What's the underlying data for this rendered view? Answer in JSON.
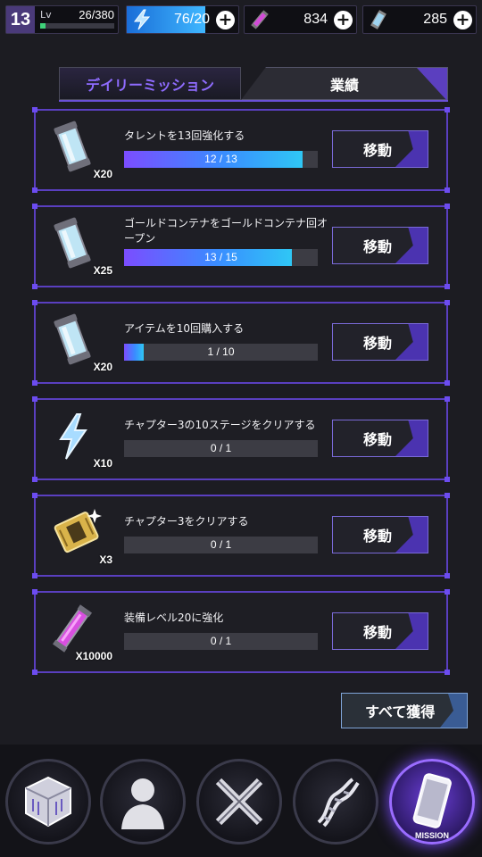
{
  "top_bar": {
    "level": "13",
    "level_label": "Lv",
    "xp_text": "26/380",
    "xp_fraction": 0.07,
    "energy": "76/20",
    "energy_fill_fraction": 0.7,
    "pink_currency": "834",
    "blue_currency": "285",
    "plus_symbol": "+"
  },
  "tabs": [
    {
      "label": "デイリーミッション"
    },
    {
      "label": "業績"
    }
  ],
  "move_label": "移動",
  "missions": [
    {
      "title": "タレントを13回強化する",
      "reward_icon": "blue-canister-icon",
      "reward_count": "X20",
      "progress_text": "12 / 13",
      "fraction": 0.923
    },
    {
      "title": "ゴールドコンテナをゴールドコンテナ回オープン",
      "reward_icon": "blue-canister-icon",
      "reward_count": "X25",
      "progress_text": "13 / 15",
      "fraction": 0.867
    },
    {
      "title": "アイテムを10回購入する",
      "reward_icon": "blue-canister-icon",
      "reward_count": "X20",
      "progress_text": "1 / 10",
      "fraction": 0.1
    },
    {
      "title": "チャプター3の10ステージをクリアする",
      "reward_icon": "lightning-icon",
      "reward_count": "X10",
      "progress_text": "0 / 1",
      "fraction": 0
    },
    {
      "title": "チャプター3をクリアする",
      "reward_icon": "gold-ticket-icon",
      "reward_count": "X3",
      "progress_text": "0 / 1",
      "fraction": 0
    },
    {
      "title": "装備レベル20に強化",
      "reward_icon": "pink-vial-icon",
      "reward_count": "X10000",
      "progress_text": "0 / 1",
      "fraction": 0
    }
  ],
  "collect_all_label": "すべて獲得",
  "bottom_nav": [
    {
      "icon": "cube-icon"
    },
    {
      "icon": "character-icon"
    },
    {
      "icon": "crossed-weapons-icon"
    },
    {
      "icon": "dna-icon"
    },
    {
      "icon": "phone-icon",
      "label": "MISSION",
      "active": true
    }
  ],
  "colors": {
    "accent_purple": "#5a3fc0",
    "progress_start": "#7b4dff",
    "progress_end": "#2fc7f5",
    "energy_blue": "#3fb7ff",
    "xp_green": "#3fd27a"
  }
}
